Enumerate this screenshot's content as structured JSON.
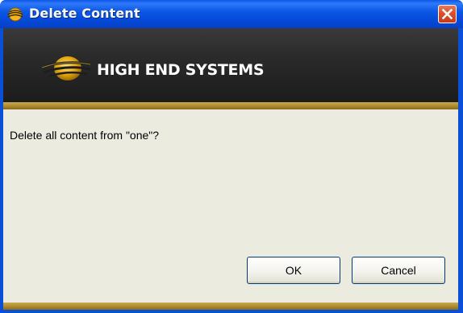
{
  "window": {
    "title": "Delete Content"
  },
  "banner": {
    "logo_text": "HIGH END SYSTEMS"
  },
  "dialog": {
    "message": "Delete all content from \"one\"?",
    "ok_label": "OK",
    "cancel_label": "Cancel"
  },
  "icons": {
    "title_icon": "globe-logo-icon",
    "close_icon": "close-icon",
    "logo_mark": "globe-logo-icon"
  },
  "colors": {
    "titlebar": "#0a56e8",
    "close_button": "#dc4e2a",
    "banner": "#2a2a2a",
    "accent_gold": "#b08d2e",
    "client_bg": "#ecebe0"
  }
}
